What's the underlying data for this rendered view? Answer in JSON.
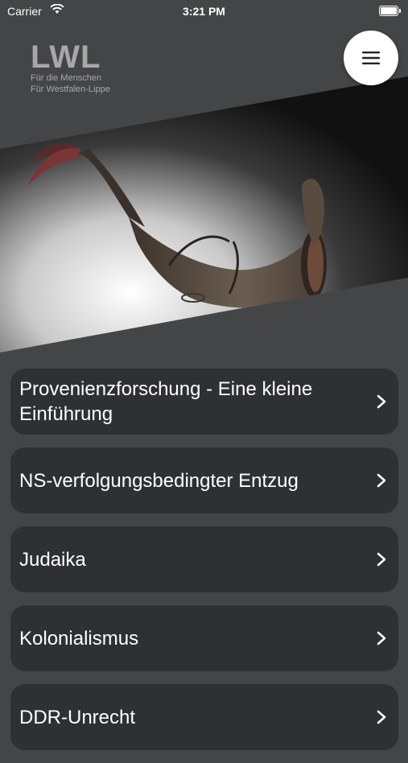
{
  "status_bar": {
    "carrier": "Carrier",
    "time": "3:21 PM"
  },
  "logo": {
    "mark": "LWL",
    "tagline_1": "Für die Menschen",
    "tagline_2": "Für Westfalen-Lippe"
  },
  "menu_button": {
    "icon": "hamburger-icon"
  },
  "hero_image": {
    "description_icon": "artifact-photo"
  },
  "items": [
    {
      "label": "Provenienzforschung - Eine kleine Einführung",
      "icon": "chevron-right-icon"
    },
    {
      "label": "NS-verfolgungsbedingter Entzug",
      "icon": "chevron-right-icon"
    },
    {
      "label": "Judaika",
      "icon": "chevron-right-icon"
    },
    {
      "label": "Kolonialismus",
      "icon": "chevron-right-icon"
    },
    {
      "label": "DDR-Unrecht",
      "icon": "chevron-right-icon"
    }
  ],
  "colors": {
    "background": "#444546",
    "card": "#2f3033",
    "text": "#ffffff"
  }
}
